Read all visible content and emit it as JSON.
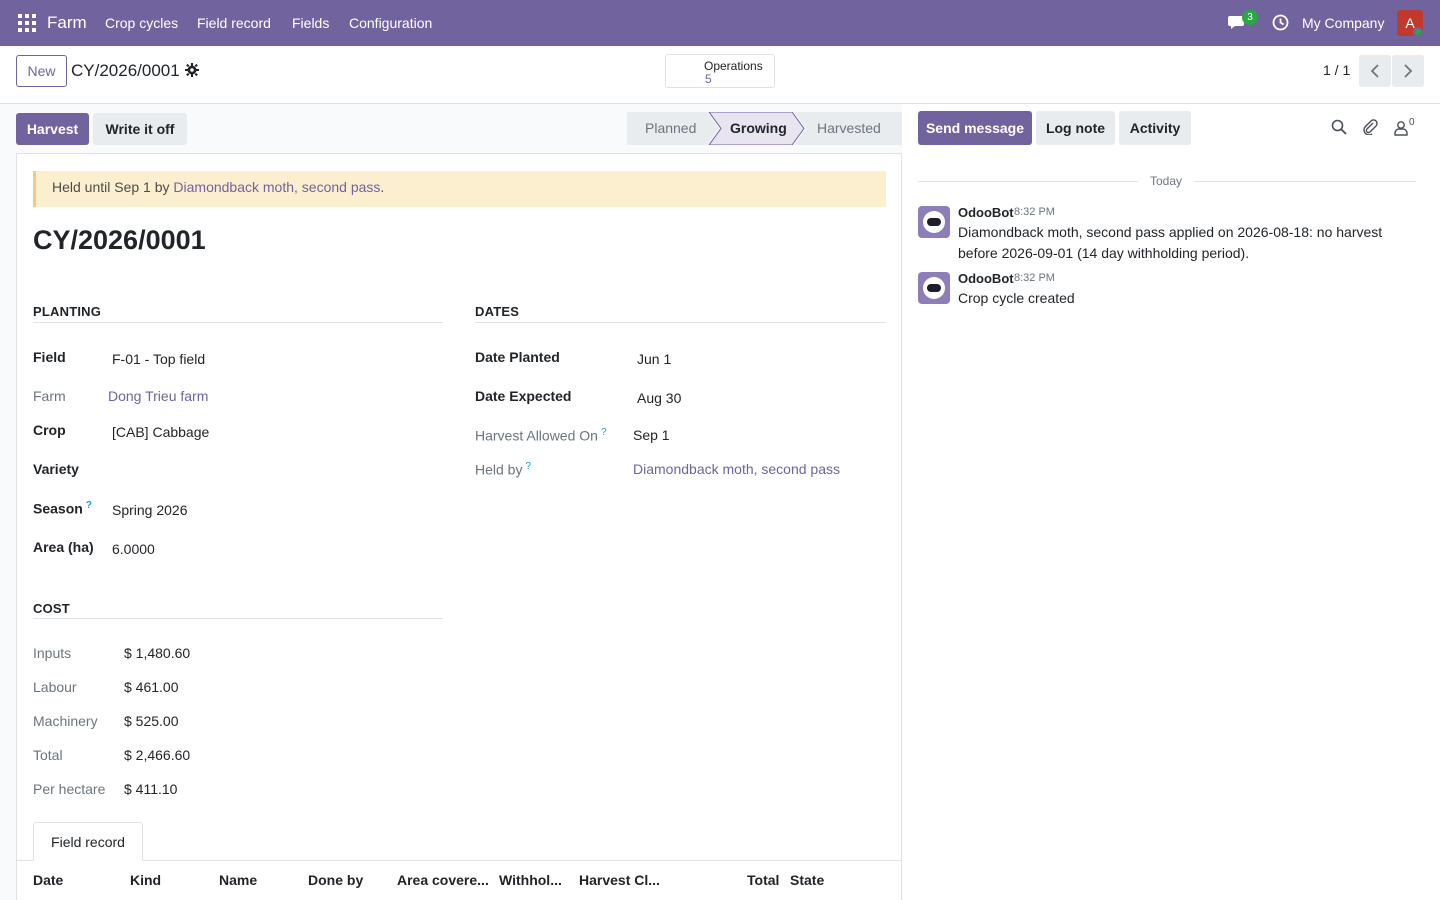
{
  "navbar": {
    "brand": "Farm",
    "menu": [
      "Crop cycles",
      "Field record",
      "Fields",
      "Configuration"
    ],
    "chat_count": "3",
    "company": "My Company",
    "avatar_letter": "A"
  },
  "control": {
    "new_label": "New",
    "record_name": "CY/2026/0001",
    "smart_button": {
      "label": "Operations",
      "value": "5"
    },
    "pager": "1 / 1"
  },
  "actions": {
    "harvest": "Harvest",
    "write_off": "Write it off"
  },
  "statusbar": {
    "stages": [
      "Planned",
      "Growing",
      "Harvested"
    ],
    "active": "Growing"
  },
  "alert": {
    "prefix": "Held until Sep 1 by ",
    "link": "Diamondback moth, second pass",
    "suffix": "."
  },
  "form": {
    "title": "CY/2026/0001",
    "planting": {
      "heading": "Planting",
      "field_label": "Field",
      "field_value": "F-01 - Top field",
      "farm_label": "Farm",
      "farm_value": "Dong Trieu farm",
      "crop_label": "Crop",
      "crop_value": "[CAB] Cabbage",
      "variety_label": "Variety",
      "variety_value": "",
      "season_label": "Season",
      "season_value": "Spring 2026",
      "area_label": "Area (ha)",
      "area_value": "6.0000"
    },
    "dates": {
      "heading": "Dates",
      "planted_label": "Date Planted",
      "planted_value": "Jun 1",
      "expected_label": "Date Expected",
      "expected_value": "Aug 30",
      "allowed_label": "Harvest Allowed On",
      "allowed_value": "Sep 1",
      "held_label": "Held by",
      "held_value": "Diamondback moth, second pass"
    },
    "cost": {
      "heading": "Cost",
      "rows": [
        {
          "label": "Inputs",
          "value": "$ 1,480.60"
        },
        {
          "label": "Labour",
          "value": "$ 461.00"
        },
        {
          "label": "Machinery",
          "value": "$ 525.00"
        },
        {
          "label": "Total",
          "value": "$ 2,466.60"
        },
        {
          "label": "Per hectare",
          "value": "$ 411.10"
        }
      ]
    },
    "help_mark": "?",
    "tab_label": "Field record",
    "table_headers": [
      "Date",
      "Kind",
      "Name",
      "Done by",
      "Area covere...",
      "Withhol...",
      "Harvest Cl...",
      "Total",
      "State"
    ]
  },
  "chatter": {
    "send_message": "Send message",
    "log_note": "Log note",
    "activity": "Activity",
    "followers_count": "0",
    "today": "Today",
    "messages": [
      {
        "author": "OdooBot",
        "time": "8:32 PM",
        "body": "Diamondback moth, second pass applied on 2026-08-18: no harvest before 2026-09-01 (14 day withholding period)."
      },
      {
        "author": "OdooBot",
        "time": "8:32 PM",
        "body": "Crop cycle created"
      }
    ]
  }
}
